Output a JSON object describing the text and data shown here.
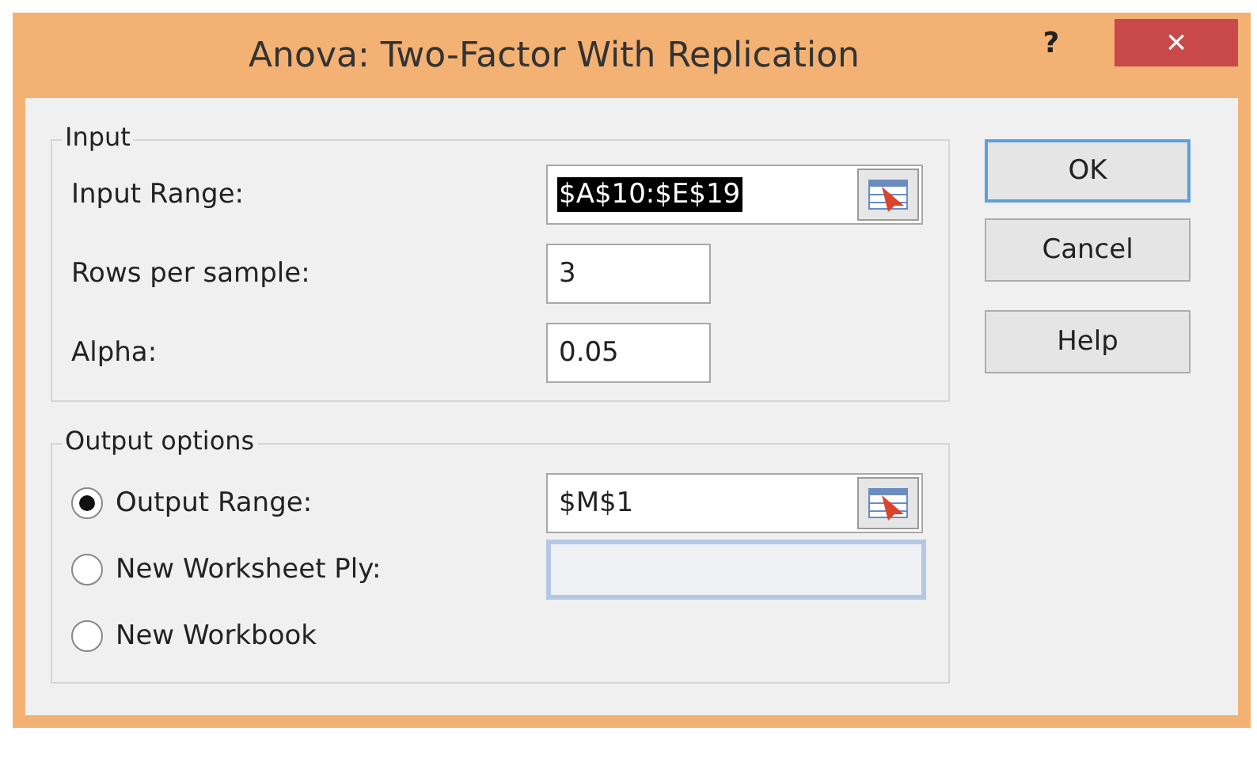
{
  "window": {
    "title": "Anova: Two-Factor With Replication"
  },
  "title_buttons": {
    "help": "?",
    "close": "×"
  },
  "input": {
    "legend": "Input",
    "fields": [
      {
        "label": "Input Range:",
        "value": "$A$10:$E$19",
        "kind": "range",
        "text_selected": true
      },
      {
        "label": "Rows per sample:",
        "value": "3",
        "kind": "short",
        "text_selected": false
      },
      {
        "label": "Alpha:",
        "value": "0.05",
        "kind": "short",
        "text_selected": false
      }
    ]
  },
  "output": {
    "legend": "Output options",
    "options": [
      {
        "label": "Output Range:",
        "selected": true,
        "field": {
          "value": "$M$1",
          "kind": "range",
          "disabled": false
        }
      },
      {
        "label": "New Worksheet Ply:",
        "selected": false,
        "field": {
          "kind": "plain",
          "disabled": true
        }
      },
      {
        "label": "New Workbook",
        "selected": false
      }
    ]
  },
  "buttons": [
    {
      "label": "OK",
      "default": true
    },
    {
      "label": "Cancel",
      "default": false
    },
    {
      "label": "Help",
      "default": false
    }
  ]
}
